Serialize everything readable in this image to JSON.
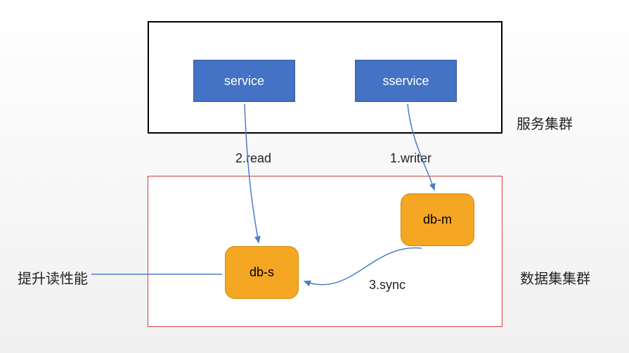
{
  "groups": {
    "service_cluster_label": "服务集群",
    "data_cluster_label": "数据集集群",
    "read_perf_label": "提升读性能"
  },
  "nodes": {
    "service1": "service",
    "service2": "sservice",
    "db_s": "db-s",
    "db_m": "db-m"
  },
  "edges": {
    "read": "2.read",
    "writer": "1.writer",
    "sync": "3.sync"
  },
  "colors": {
    "service_bg": "#4472c4",
    "db_bg": "#f5a623",
    "arrow": "#4a7ec8",
    "data_border": "#d04040"
  }
}
